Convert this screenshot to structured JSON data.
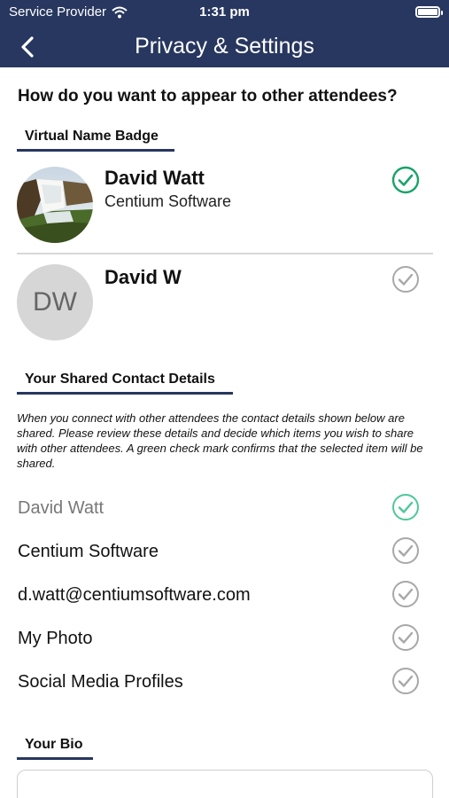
{
  "status_bar": {
    "carrier": "Service Provider",
    "time": "1:31 pm"
  },
  "nav": {
    "title": "Privacy & Settings"
  },
  "question": "How do you want to appear to other attendees?",
  "name_badge": {
    "label": "Virtual Name Badge",
    "options": [
      {
        "name": "David Watt",
        "company": "Centium Software",
        "avatar": "photo",
        "selected": true
      },
      {
        "name": "David W",
        "initials": "DW",
        "avatar": "initials",
        "selected": false
      }
    ]
  },
  "contact": {
    "label": "Your Shared Contact Details",
    "notice": "When you connect with other attendees the contact details shown below are shared. Please review these details and decide which items you wish to share with other attendees. A green check mark confirms that the selected item will be shared.",
    "items": [
      {
        "label": "David Watt",
        "shared": true
      },
      {
        "label": "Centium Software",
        "shared": false
      },
      {
        "label": "d.watt@centiumsoftware.com",
        "shared": false
      },
      {
        "label": "My Photo",
        "shared": false
      },
      {
        "label": "Social Media Profiles",
        "shared": false
      }
    ]
  },
  "bio": {
    "label": "Your Bio"
  },
  "colors": {
    "nav_background": "#27375f",
    "check_selected": "#1aa36a",
    "check_unselected": "#a8a8a8"
  }
}
